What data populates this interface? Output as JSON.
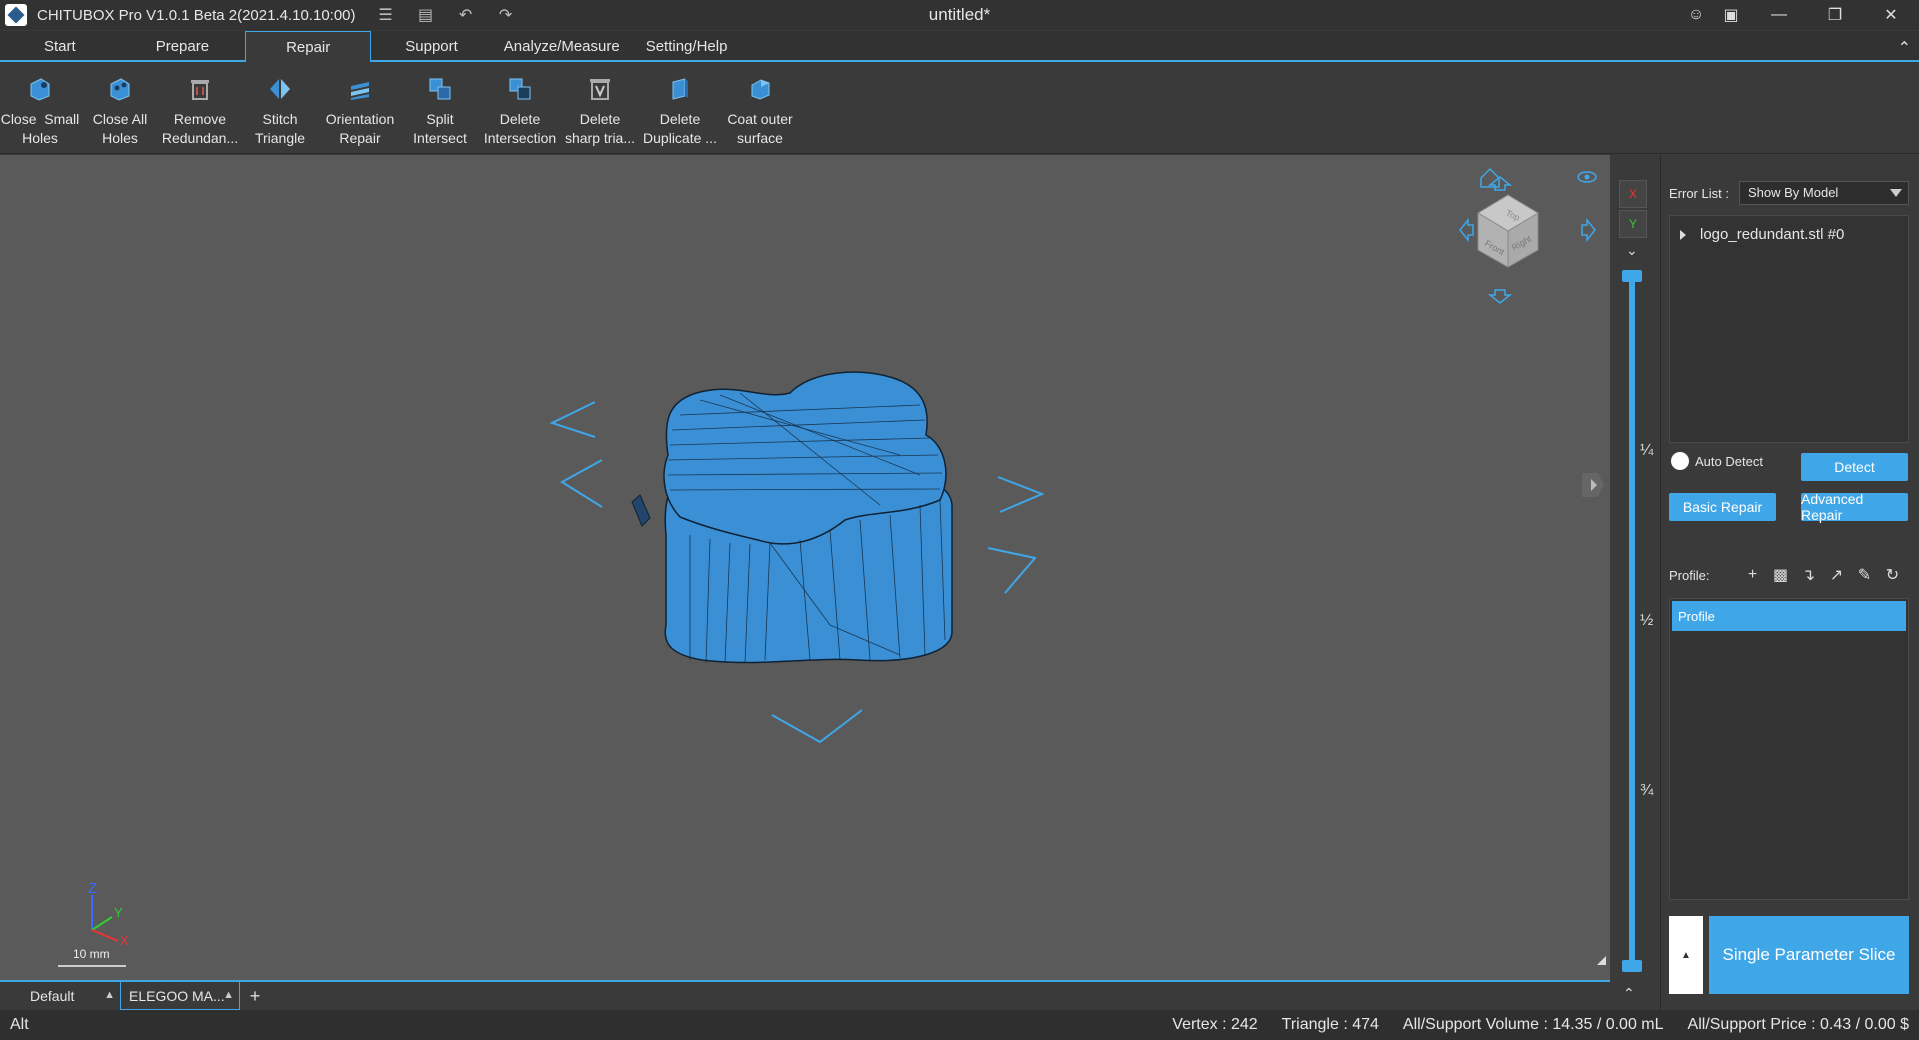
{
  "titlebar": {
    "app_title": "CHITUBOX Pro V1.0.1 Beta 2(2021.4.10.10:00)",
    "doc_title": "untitled*",
    "quick_icons": [
      "document-icon",
      "save-icon",
      "undo-icon",
      "redo-icon"
    ],
    "win_icons": [
      "user-icon",
      "screenshot-icon",
      "minimize-icon",
      "restore-icon",
      "close-icon"
    ]
  },
  "tabs": [
    {
      "label": "Start"
    },
    {
      "label": "Prepare"
    },
    {
      "label": "Repair",
      "active": true
    },
    {
      "label": "Support"
    },
    {
      "label": "Analyze/Measure"
    },
    {
      "label": "Setting/Help"
    }
  ],
  "ribbon": {
    "buttons": [
      {
        "label": "Close  Small\nHoles",
        "icon": "close-small-holes-icon"
      },
      {
        "label": "Close All\nHoles",
        "icon": "close-all-holes-icon"
      },
      {
        "label": "Remove\nRedundan...",
        "icon": "remove-redundant-icon"
      },
      {
        "label": "Stitch\nTriangle",
        "icon": "stitch-triangle-icon"
      },
      {
        "label": "Orientation\nRepair",
        "icon": "orientation-repair-icon"
      },
      {
        "label": "Split\nIntersect",
        "icon": "split-intersect-icon"
      },
      {
        "label": "Delete\nIntersection",
        "icon": "delete-intersection-icon"
      },
      {
        "label": "Delete\nsharp tria...",
        "icon": "delete-sharp-triangle-icon"
      },
      {
        "label": "Delete\nDuplicate ...",
        "icon": "delete-duplicate-icon"
      },
      {
        "label": "Coat outer\nsurface",
        "icon": "coat-outer-surface-icon"
      }
    ]
  },
  "viewport": {
    "axes": {
      "x": "X",
      "y": "Y",
      "z": "Z"
    },
    "scale_label": "10 mm",
    "viewcube_faces": {
      "top": "Top",
      "front": "Front",
      "right": "Right"
    }
  },
  "layer_slider": {
    "axis_x": "X",
    "axis_y": "Y",
    "fractions": [
      "¼",
      "½",
      "¾"
    ]
  },
  "right_panel": {
    "error_list_label": "Error List :",
    "error_list_value": "Show By Model",
    "tree_item": "logo_redundant.stl #0",
    "auto_detect": "Auto Detect",
    "detect": "Detect",
    "basic_repair": "Basic Repair",
    "advanced_repair": "Advanced Repair",
    "profile_label": "Profile:",
    "profile_item": "Profile",
    "slice_button": "Single Parameter Slice"
  },
  "printer_tabs": [
    {
      "label": "Default"
    },
    {
      "label": "ELEGOO MA...",
      "active": true
    }
  ],
  "status": {
    "mode": "Alt",
    "vertex": "Vertex : 242",
    "triangle": "Triangle : 474",
    "volume": "All/Support Volume : 14.35 / 0.00 mL",
    "price": "All/Support Price : 0.43 / 0.00 $"
  },
  "colors": {
    "accent": "#3fa7e8",
    "model": "#3b8fd4",
    "viewport_bg": "#5a5a5a"
  }
}
